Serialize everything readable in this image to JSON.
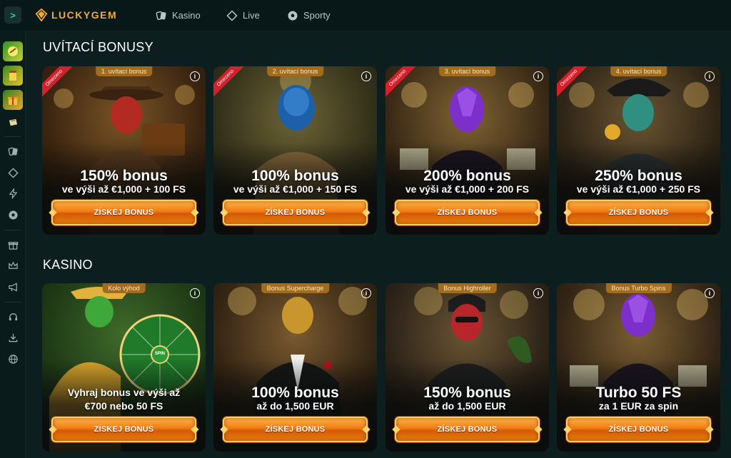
{
  "brand": {
    "name": "LUCKYGEM"
  },
  "nav": [
    {
      "label": "Kasino",
      "icon": "cards-icon"
    },
    {
      "label": "Live",
      "icon": "diamond-icon"
    },
    {
      "label": "Sporty",
      "icon": "soccer-ball-icon"
    }
  ],
  "sidebar": {
    "icons": [
      "promo-1-icon",
      "promo-2-icon",
      "promo-3-icon",
      "ticket-icon",
      "cards-icon",
      "diamond-icon",
      "lightning-icon",
      "soccer-ball-icon",
      "gift-icon",
      "crown-icon",
      "megaphone-icon",
      "headset-icon",
      "download-icon",
      "globe-icon"
    ]
  },
  "sections": [
    {
      "title": "UVÍTACÍ BONUSY",
      "cards": [
        {
          "tag": "1. uvítací bonus",
          "ribbon": "Omezeno",
          "headline": "150% bonus",
          "subline": "ve výši až €1,000 + 100 FS",
          "cta": "ZÍSKEJ BONUS",
          "theme": "red"
        },
        {
          "tag": "2. uvítací bonus",
          "ribbon": "Omezeno",
          "headline": "100% bonus",
          "subline": "ve výši až €1,000 + 150 FS",
          "cta": "ZÍSKEJ BONUS",
          "theme": "blue"
        },
        {
          "tag": "3. uvítací bonus",
          "ribbon": "Omezeno",
          "headline": "200% bonus",
          "subline": "ve výši až €1,000 + 200 FS",
          "cta": "ZÍSKEJ BONUS",
          "theme": "purple"
        },
        {
          "tag": "4. uvítací bonus",
          "ribbon": "Omezeno",
          "headline": "250% bonus",
          "subline": "ve výši až €1,000 + 250 FS",
          "cta": "ZÍSKEJ BONUS",
          "theme": "teal"
        }
      ]
    },
    {
      "title": "KASINO",
      "cards": [
        {
          "tag": "Kolo výhod",
          "ribbon": "",
          "headline": "Vyhraj bonus ve výši až",
          "subline": "€700 nebo 50 FS",
          "cta": "ZÍSKEJ BONUS",
          "theme": "green",
          "wheel_center": "SPIN"
        },
        {
          "tag": "Bonus Supercharge",
          "ribbon": "",
          "headline": "100% bonus",
          "subline": "až do 1,500 EUR",
          "cta": "ZÍSKEJ BONUS",
          "theme": "gold"
        },
        {
          "tag": "Bonus Highroller",
          "ribbon": "",
          "headline": "150% bonus",
          "subline": "až do 1,500 EUR",
          "cta": "ZÍSKEJ BONUS",
          "theme": "crimson"
        },
        {
          "tag": "Bonus Turbo Spins",
          "ribbon": "",
          "headline": "Turbo 50 FS",
          "subline": "za 1 EUR za spin",
          "cta": "ZÍSKEJ BONUS",
          "theme": "violet"
        }
      ]
    }
  ],
  "info_symbol": "i",
  "toggle_symbol": ">"
}
